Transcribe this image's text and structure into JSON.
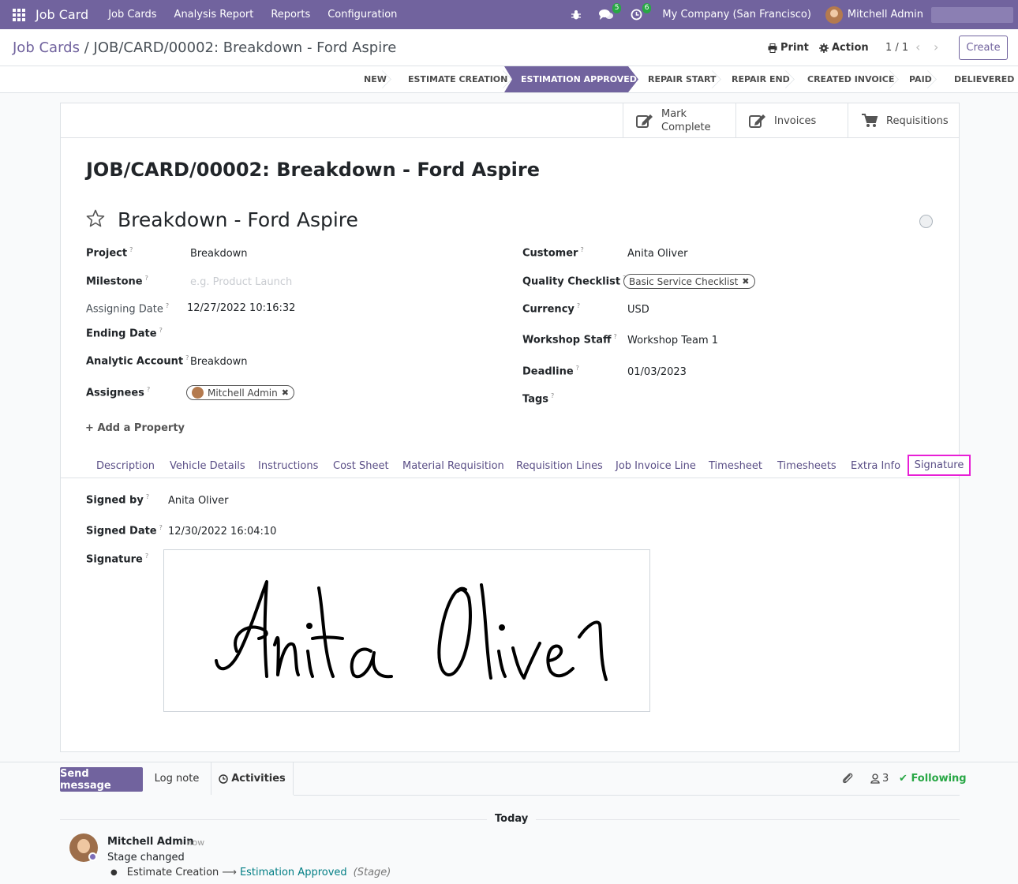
{
  "navbar": {
    "app_title": "Job Card",
    "menu": [
      "Job Cards",
      "Analysis Report",
      "Reports",
      "Configuration"
    ],
    "messages_badge": "5",
    "activities_badge": "6",
    "company": "My Company (San Francisco)",
    "user": "Mitchell Admin",
    "color": "#71639e"
  },
  "breadcrumb": {
    "parent": "Job Cards",
    "separator": "/",
    "current": "JOB/CARD/00002: Breakdown - Ford Aspire"
  },
  "controls": {
    "print": "Print",
    "action": "Action",
    "pager": "1 / 1",
    "create": "Create"
  },
  "stages": [
    "NEW",
    "ESTIMATE CREATION",
    "ESTIMATION APPROVED",
    "REPAIR START",
    "REPAIR END",
    "CREATED INVOICE",
    "PAID",
    "DELIEVERED"
  ],
  "active_stage": "ESTIMATION APPROVED",
  "smart_buttons": {
    "mark_line1": "Mark",
    "mark_line2": "Complete",
    "invoices": "Invoices",
    "requisitions": "Requisitions"
  },
  "record": {
    "title": "JOB/CARD/00002: Breakdown - Ford Aspire",
    "name": "Breakdown - Ford Aspire"
  },
  "fields_left": {
    "project_label": "Project",
    "project": "Breakdown",
    "milestone_label": "Milestone",
    "milestone_placeholder": "e.g. Product Launch",
    "assigning_date_label": "Assigning Date",
    "assigning_date": "12/27/2022 10:16:32",
    "ending_date_label": "Ending Date",
    "analytic_label": "Analytic Account",
    "analytic": "Breakdown",
    "assignees_label": "Assignees",
    "assignee": "Mitchell Admin"
  },
  "fields_right": {
    "customer_label": "Customer",
    "customer": "Anita Oliver",
    "checklist_label": "Quality Checklist",
    "checklist": "Basic Service Checklist",
    "currency_label": "Currency",
    "currency": "USD",
    "staff_label": "Workshop Staff",
    "staff": "Workshop Team 1",
    "deadline_label": "Deadline",
    "deadline": "01/03/2023",
    "tags_label": "Tags"
  },
  "help_mark": "?",
  "add_property": "Add a Property",
  "tabs": [
    "Description",
    "Vehicle Details",
    "Instructions",
    "Cost Sheet",
    "Material Requisition",
    "Requisition Lines",
    "Job Invoice Line",
    "Timesheet",
    "Timesheets",
    "Extra Info",
    "Signature"
  ],
  "signature_tab": {
    "signed_by_label": "Signed by",
    "signed_by": "Anita Oliver",
    "signed_date_label": "Signed Date",
    "signed_date": "12/30/2022 16:04:10",
    "signature_label": "Signature",
    "signature_image_text": "Anita Oliver"
  },
  "chatter": {
    "send_message": "Send message",
    "log_note": "Log note",
    "activities": "Activities",
    "followers_count": "3",
    "following": "Following",
    "date_separator": "Today",
    "message": {
      "author": "Mitchell Admin",
      "time": "- now",
      "body": "Stage changed",
      "old_value": "Estimate Creation",
      "new_value": "Estimation Approved",
      "field": "(Stage)"
    }
  }
}
